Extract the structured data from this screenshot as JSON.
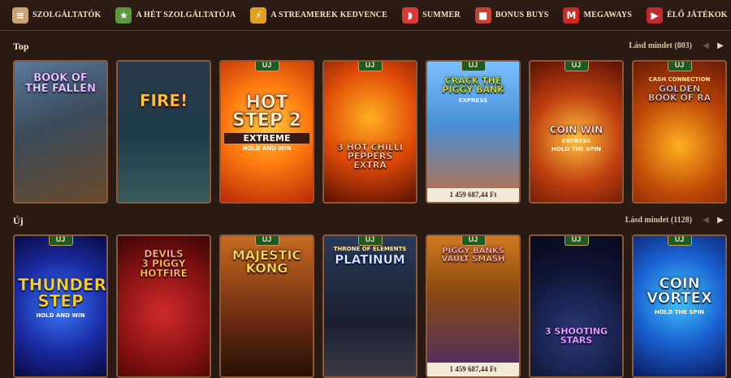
{
  "nav": {
    "items": [
      {
        "label": "SZOLGÁLTATÓK",
        "icon": "scroll-icon",
        "color": "#c9a574"
      },
      {
        "label": "A HÉT SZOLGÁLTATÓJA",
        "icon": "trophy-icon",
        "color": "#5a9a3a"
      },
      {
        "label": "A STREAMEREK KEDVENCE",
        "icon": "lightning-icon",
        "color": "#e0a020"
      },
      {
        "label": "SUMMER",
        "icon": "watermelon-icon",
        "color": "#d83a3a"
      },
      {
        "label": "BONUS BUYS",
        "icon": "gift-icon",
        "color": "#c8402a"
      },
      {
        "label": "MEGAWAYS",
        "icon": "m-logo-icon",
        "color": "#d02a20"
      },
      {
        "label": "ÉLŐ JÁTÉKOK",
        "icon": "live-chip-icon",
        "color": "#c02a2a"
      }
    ]
  },
  "sections": [
    {
      "title": "Top",
      "see_all": "Lásd mindet (803)",
      "games": [
        {
          "title_lines": [
            "BOOK OF",
            "THE FALLEN"
          ],
          "new": false,
          "jackpot": "",
          "theme": "book"
        },
        {
          "title_lines": [
            "FIRE!"
          ],
          "new": false,
          "jackpot": "",
          "theme": "fire"
        },
        {
          "title_lines": [
            "HOT",
            "STEP 2"
          ],
          "sub": "EXTREME",
          "sub2": "HOLD AND WIN",
          "new": true,
          "jackpot": "",
          "theme": "hotstep"
        },
        {
          "title_lines": [
            "3 HOT CHILLI",
            "PEPPERS",
            "EXTRA"
          ],
          "new": true,
          "jackpot": "",
          "theme": "chilli"
        },
        {
          "title_lines": [
            "CRACK THE",
            "PIGGY BANK"
          ],
          "sub": "EXPRESS",
          "new": true,
          "jackpot": "1 459 687,44 Ft",
          "theme": "piggy"
        },
        {
          "title_lines": [
            "COIN WIN"
          ],
          "sub": "EXPRESS",
          "sub2": "HOLD THE SPIN",
          "new": true,
          "jackpot": "",
          "theme": "coinwin"
        },
        {
          "title_lines": [
            "GOLDEN",
            "BOOK OF RA"
          ],
          "sub": "CASH CONNECTION",
          "new": true,
          "jackpot": "",
          "theme": "goldenbook"
        }
      ]
    },
    {
      "title": "Új",
      "see_all": "Lásd mindet (1128)",
      "games": [
        {
          "title_lines": [
            "THUNDER",
            "STEP"
          ],
          "sub2": "HOLD AND WIN",
          "new": true,
          "jackpot": "",
          "theme": "thunder"
        },
        {
          "title_lines": [
            "DEVILS",
            "3 PIGGY",
            "HOTFIRE"
          ],
          "new": false,
          "jackpot": "",
          "theme": "devils"
        },
        {
          "title_lines": [
            "MAJESTIC",
            "KONG"
          ],
          "new": true,
          "jackpot": "",
          "theme": "kong"
        },
        {
          "title_lines": [
            "PLATINUM"
          ],
          "sub": "THRONE OF ELEMENTS",
          "new": true,
          "jackpot": "",
          "theme": "platinum"
        },
        {
          "title_lines": [
            "PIGGY BANKS",
            "VAULT SMASH"
          ],
          "new": true,
          "jackpot": "1 459 687,44 Ft",
          "theme": "vault"
        },
        {
          "title_lines": [
            "3 SHOOTING",
            "STARS"
          ],
          "new": true,
          "jackpot": "",
          "theme": "stars"
        },
        {
          "title_lines": [
            "COIN",
            "VORTEX"
          ],
          "sub2": "HOLD THE SPIN",
          "new": true,
          "jackpot": "",
          "theme": "vortex"
        }
      ]
    }
  ],
  "labels": {
    "new_badge": "ÚJ"
  },
  "colors": {
    "background": "#2a1a14",
    "card_border": "#8a5a3a",
    "badge_green": "#1e5a28",
    "text_light": "#f0e2c6"
  }
}
